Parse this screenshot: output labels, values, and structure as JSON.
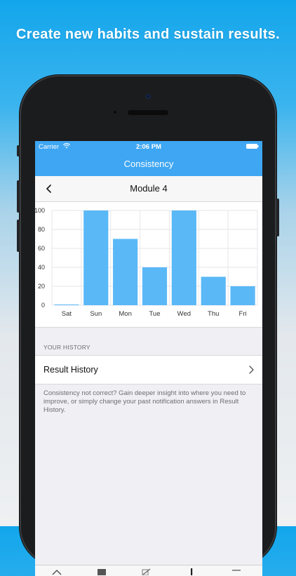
{
  "headline": "Create new habits and sustain results.",
  "status": {
    "carrier": "Carrier",
    "time": "2:06 PM"
  },
  "nav": {
    "title": "Consistency"
  },
  "subnav": {
    "title": "Module 4"
  },
  "history": {
    "section_header": "YOUR HISTORY",
    "row_label": "Result History",
    "footnote": "Consistency not correct? Gain deeper insight into where you need to improve, or simply change your past notification answers in Result History."
  },
  "colors": {
    "accent": "#3ea6f2",
    "bar": "#5ab8f7"
  },
  "chart_data": {
    "type": "bar",
    "categories": [
      "Sat",
      "Sun",
      "Mon",
      "Tue",
      "Wed",
      "Thu",
      "Fri"
    ],
    "values": [
      0,
      100,
      70,
      40,
      100,
      30,
      20
    ],
    "yticks": [
      0,
      20,
      40,
      60,
      80,
      100
    ],
    "ylim": [
      0,
      100
    ],
    "grid": true
  }
}
